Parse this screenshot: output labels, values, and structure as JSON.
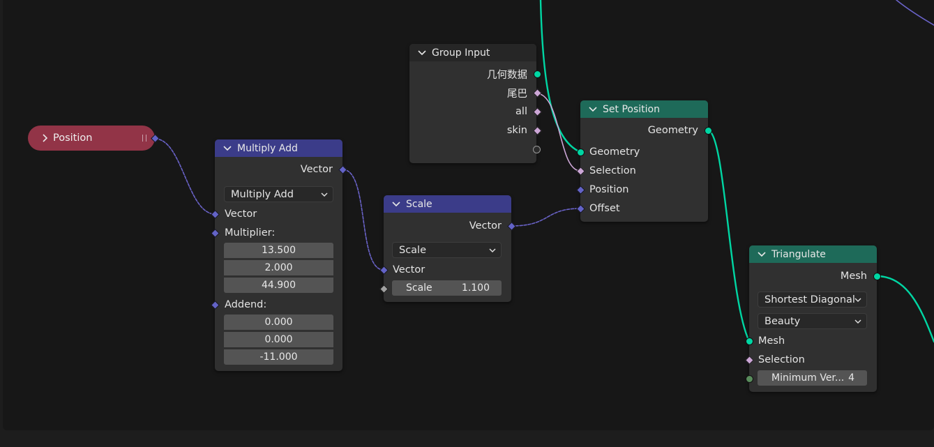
{
  "nodes": {
    "position": {
      "label": "Position"
    },
    "group_input": {
      "title": "Group Input",
      "outputs": [
        "几何数据",
        "尾巴",
        "all",
        "skin"
      ]
    },
    "multiply_add": {
      "title": "Multiply Add",
      "output": "Vector",
      "operation": "Multiply Add",
      "input_vector": "Vector",
      "multiplier_label": "Multiplier:",
      "multiplier": [
        "13.500",
        "2.000",
        "44.900"
      ],
      "addend_label": "Addend:",
      "addend": [
        "0.000",
        "0.000",
        "-11.000"
      ]
    },
    "scale": {
      "title": "Scale",
      "output": "Vector",
      "operation": "Scale",
      "input_vector": "Vector",
      "scale_label": "Scale",
      "scale_value": "1.100"
    },
    "set_position": {
      "title": "Set Position",
      "output": "Geometry",
      "inputs": [
        "Geometry",
        "Selection",
        "Position",
        "Offset"
      ]
    },
    "triangulate": {
      "title": "Triangulate",
      "output": "Mesh",
      "quad_method": "Shortest Diagonal",
      "ngon_method": "Beauty",
      "inputs": [
        "Mesh",
        "Selection"
      ],
      "min_vertices_label": "Minimum Ver...",
      "min_vertices_value": "4"
    }
  },
  "colors": {
    "geometry_socket": "#00d6a3",
    "vector_socket": "#6363c7",
    "bool_socket": "#cca6d6",
    "int_socket": "#598c5c",
    "header_vector": "#3b3c89",
    "header_geometry": "#1e6a59",
    "position_node": "#923447"
  }
}
